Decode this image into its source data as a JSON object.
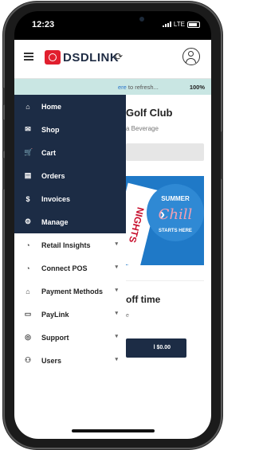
{
  "status": {
    "time": "12:23",
    "network": "LTE"
  },
  "header": {
    "brand": "DSDLINK"
  },
  "banner": {
    "link_prefix": "ere",
    "link_rest": " to refresh...",
    "progress": "100%"
  },
  "content": {
    "club_title": "Golf Club",
    "beverage": "a Beverage",
    "promo_line1": "SUMMER",
    "promo_line2": "Chill",
    "promo_line3": "STARTS HERE",
    "offtime_title": "off time",
    "offtime_sub": "e",
    "pay_button": "l $0.00"
  },
  "menu": {
    "items": [
      {
        "label": "Home",
        "icon": "home-icon",
        "glyph": "⌂"
      },
      {
        "label": "Shop",
        "icon": "envelope-icon",
        "glyph": "✉"
      },
      {
        "label": "Cart",
        "icon": "cart-icon",
        "glyph": "🛒"
      },
      {
        "label": "Orders",
        "icon": "document-icon",
        "glyph": "▤"
      },
      {
        "label": "Invoices",
        "icon": "dollar-icon",
        "glyph": "$"
      },
      {
        "label": "Manage",
        "icon": "gear-icon",
        "glyph": "⚙"
      },
      {
        "label": "Retail Insights",
        "icon": "gauge-icon",
        "glyph": "◔"
      },
      {
        "label": "Connect POS",
        "icon": "gauge-icon",
        "glyph": "◔"
      },
      {
        "label": "Payment Methods",
        "icon": "bank-icon",
        "glyph": "⌂"
      },
      {
        "label": "PayLink",
        "icon": "money-icon",
        "glyph": "▭"
      },
      {
        "label": "Support",
        "icon": "lifebuoy-icon",
        "glyph": "◎"
      },
      {
        "label": "Users",
        "icon": "users-icon",
        "glyph": "⚇"
      }
    ]
  }
}
